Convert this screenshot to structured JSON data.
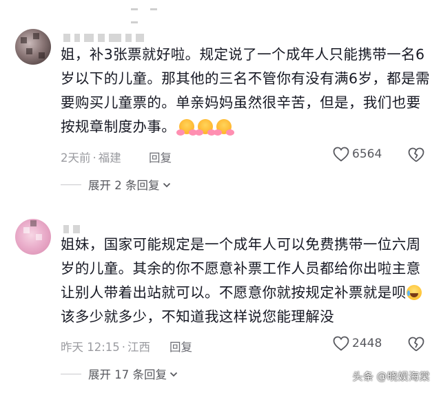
{
  "comments": [
    {
      "text": "姐，补3张票就好啦。规定说了一个成年人只能携带一名6岁以下的儿童。那其他的三名不管你有没有满6岁，都是需要购买儿童票的。单亲妈妈虽然很辛苦，但是，我们也要按规章制度办事。",
      "emoji": [
        "hugging-face",
        "hugging-face",
        "hugging-face"
      ],
      "time": "2天前",
      "dot": "·",
      "location": "福建",
      "reply_label": "回复",
      "likes": "6564",
      "expand_label": "展开 2 条回复"
    },
    {
      "text_a": "姐妹，国家可能规定是一个成年人可以免费携带一位六周岁的儿童。其余的你不愿意补票工作人员都给你出啦主意让别人带着出站就可以。不愿意你就按规定补票就是呗",
      "emoji": [
        "laughing-tears"
      ],
      "text_b": "该多少就多少，不知道我这样说您能理解没",
      "time": "昨天 12:15",
      "dot": "·",
      "location": "江西",
      "reply_label": "回复",
      "likes": "2448",
      "expand_label": "展开 17 条回复"
    }
  ],
  "watermark": {
    "brand": "头条",
    "handle": "@晓娱海棠"
  }
}
